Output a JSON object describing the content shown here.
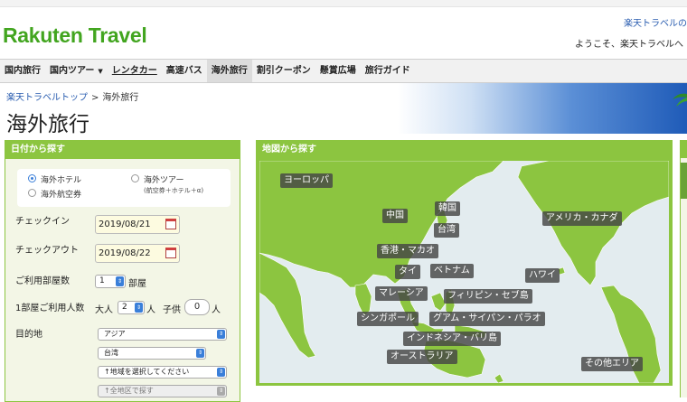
{
  "header": {
    "logo": "Rakuten Travel",
    "top_link": "楽天トラベルの",
    "welcome": "ようこそ、楽天トラベルへ"
  },
  "nav": {
    "items": [
      {
        "label": "国内旅行"
      },
      {
        "label": "国内ツアー"
      },
      {
        "label": "レンタカー"
      },
      {
        "label": "高速バス"
      },
      {
        "label": "海外旅行"
      },
      {
        "label": "割引クーポン"
      },
      {
        "label": "懸賞広場"
      },
      {
        "label": "旅行ガイド"
      }
    ]
  },
  "breadcrumb": {
    "home": "楽天トラベルトップ",
    "separator": ">",
    "current": "海外旅行"
  },
  "page_title": "海外旅行",
  "search": {
    "header": "日付から探す",
    "types": {
      "hotel": "海外ホテル",
      "air": "海外航空券",
      "tour": "海外ツアー",
      "tour_sub": "(航空券＋ホテル＋α)"
    },
    "checkin_label": "チェックイン",
    "checkin_value": "2019/08/21",
    "checkout_label": "チェックアウト",
    "checkout_value": "2019/08/22",
    "rooms_label": "ご利用部屋数",
    "rooms_value": "1",
    "rooms_unit": "部屋",
    "people_label": "1部屋ご利用人数",
    "adult_label": "大人",
    "adult_value": "2",
    "adult_unit": "人",
    "child_label": "子供",
    "child_value": "0",
    "child_unit": "人",
    "destination_label": "目的地",
    "dest_region": "アジア",
    "dest_country": "台湾",
    "dest_area": "↑地域を選択してください",
    "dest_sub": "↑全地区で探す"
  },
  "map": {
    "header": "地図から探す",
    "regions": [
      "ヨーロッパ",
      "中国",
      "韓国",
      "台湾",
      "アメリカ・カナダ",
      "香港・マカオ",
      "タイ",
      "ベトナム",
      "ハワイ",
      "マレーシア",
      "フィリピン・セブ島",
      "シンガポール",
      "グアム・サイパン・パラオ",
      "インドネシア・バリ島",
      "オーストラリア",
      "その他エリア"
    ]
  },
  "colors": {
    "brand_green": "#42a51f",
    "panel_green": "#8cc540",
    "link_blue": "#2a5db0",
    "land_green": "#8cc540",
    "sea": "#e3ecef"
  }
}
